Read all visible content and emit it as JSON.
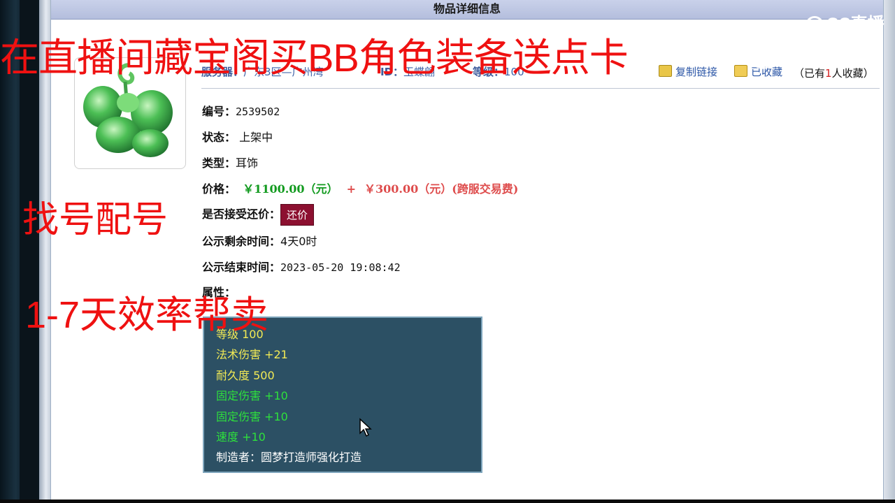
{
  "panel": {
    "title": "物品详细信息"
  },
  "server_row": {
    "server_label": "服务器：",
    "server_value": "广东3区—广州湾",
    "id_label": "ID：",
    "id_value": "玉蝶翩",
    "level_label": "等级：",
    "level_value": "100",
    "copy_link": "复制链接",
    "favorited": "已收藏",
    "fav_prefix": "（已有",
    "fav_num": "1",
    "fav_suffix": "人收藏）"
  },
  "info": {
    "number_label": "编号：",
    "number_value": "2539502",
    "status_label": "状态：",
    "status_value": "上架中",
    "type_label": "类型：",
    "type_value": "耳饰",
    "price_label": "价格：",
    "price_main": "￥1100.00（元）",
    "price_plus": "+",
    "price_fee": "￥300.00（元）(跨服交易费)",
    "counter_label": "是否接受还价：",
    "counter_button": "还价",
    "remain_label": "公示剩余时间：",
    "remain_value": "4天0时",
    "end_label": "公示结束时间：",
    "end_value": "2023-05-20 19:08:42",
    "attr_label": "属性："
  },
  "attributes": {
    "line1": "等级 100",
    "line2": "法术伤害 +21",
    "line3": "耐久度 500",
    "line4": "固定伤害 +10",
    "line5": "固定伤害 +10",
    "line6": "速度 +10",
    "line7": "制造者：圆梦打造师强化打造"
  },
  "overlay": {
    "line1": "在直播间藏宝阁买BB角色装备送点卡",
    "line2": "找号配号",
    "line3": "1-7天效率帮卖"
  },
  "watermark": {
    "logo1": "CC直播",
    "logo2": "CC直播"
  },
  "colors": {
    "overlay_red": "#ef1111",
    "price_green": "#119a1e",
    "price_red": "#de4c4c",
    "attr_bg": "#2c5064",
    "attr_yellow": "#f2ea55",
    "attr_green": "#2ee03c"
  },
  "icons": [
    "jade-earring-item-icon",
    "copy-link-icon",
    "favorite-folder-icon",
    "mouse-cursor-icon",
    "cc-live-logo-icon"
  ]
}
